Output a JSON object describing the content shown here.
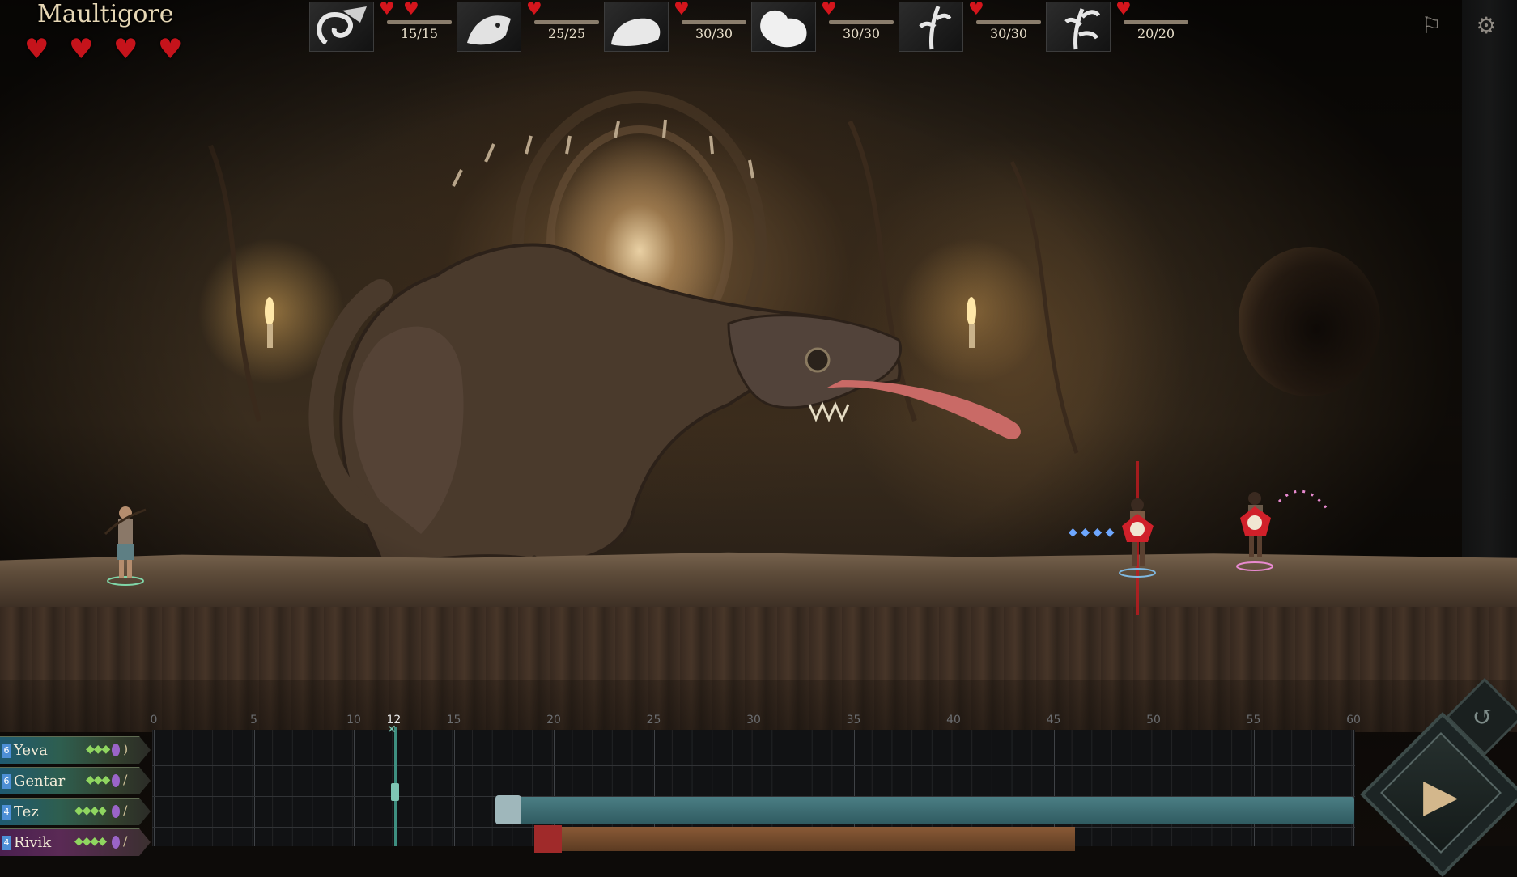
{
  "boss": {
    "name": "Maultigore",
    "hearts": 4
  },
  "party": [
    {
      "icon": "serpent-portrait-icon",
      "hp": "15/15",
      "hearts": 2
    },
    {
      "icon": "beast-portrait-icon",
      "hp": "25/25",
      "hearts": 1
    },
    {
      "icon": "rat-portrait-icon",
      "hp": "30/30",
      "hearts": 1
    },
    {
      "icon": "creature-portrait-icon",
      "hp": "30/30",
      "hearts": 1
    },
    {
      "icon": "plant-portrait-icon",
      "hp": "30/30",
      "hearts": 1
    },
    {
      "icon": "tree-portrait-icon",
      "hp": "20/20",
      "hearts": 1
    }
  ],
  "timeline": {
    "ticks": [
      "0",
      "5",
      "10",
      "12",
      "15",
      "20",
      "25",
      "30",
      "35",
      "40",
      "45",
      "50",
      "55",
      "60"
    ],
    "current": "12"
  },
  "units": [
    {
      "name": "Yeva",
      "level": "6",
      "pips": "◆◆◆"
    },
    {
      "name": "Gentar",
      "level": "6",
      "pips": "◆◆◆"
    },
    {
      "name": "Tez",
      "level": "4",
      "pips": "◆◆◆◆"
    },
    {
      "name": "Rivik",
      "level": "4",
      "pips": "◆◆◆◆"
    }
  ],
  "colors": {
    "heart": "#c5131b",
    "accent": "#7fc6b4"
  }
}
